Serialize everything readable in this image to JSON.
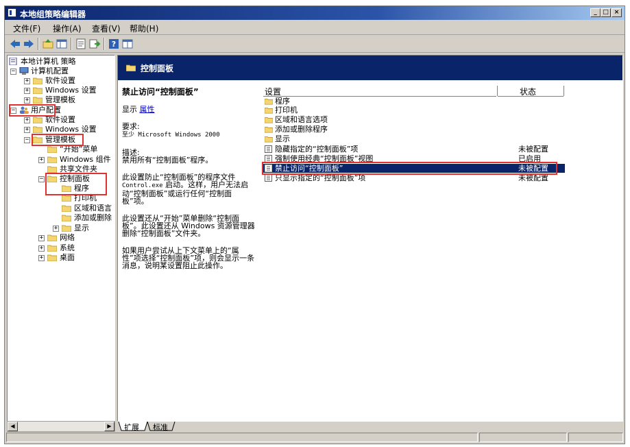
{
  "window": {
    "title": "本地组策略编辑器"
  },
  "menu": [
    "文件(F)",
    "操作(A)",
    "查看(V)",
    "帮助(H)"
  ],
  "tree": {
    "root": "本地计算机 策略",
    "computer_config": "计算机配置",
    "cc_software": "软件设置",
    "cc_windows": "Windows 设置",
    "cc_admin": "管理模板",
    "user_config": "用户配置",
    "uc_software": "软件设置",
    "uc_windows": "Windows 设置",
    "uc_admin": "管理模板",
    "start_menu": "“开始”菜单",
    "windows_components": "Windows 组件",
    "shared_folders": "共享文件夹",
    "control_panel": "控制面板",
    "cp_programs": "程序",
    "cp_printers": "打印机",
    "cp_regional": "区域和语言",
    "cp_addremove": "添加或删除",
    "cp_display": "显示",
    "network": "网络",
    "system": "系统",
    "desktop": "桌面"
  },
  "right": {
    "header_title": "控制面板",
    "desc": {
      "heading": "禁止访问“控制面板”",
      "show_label": "显示",
      "properties_link": "属性",
      "req_label": "要求:",
      "req_value": "至少 Microsoft Windows 2000",
      "desc_label": "描述:",
      "desc_line": "禁用所有“控制面板”程序。",
      "para1a": "此设置防止“控制面板”的程序文件",
      "para1b": "Control.exe",
      "para1c": "启动。这样，用户无法启动“控制面板”或运行任何“控制面板”项。",
      "para2": "此设置还从“开始”菜单删除“控制面板”。此设置还从 Windows 资源管理器删除“控制面板”文件夹。",
      "para3": "如果用户尝试从上下文菜单上的“属性”项选择“控制面板”项，则会显示一条消息，说明某设置阻止此操作。"
    },
    "columns": {
      "setting": "设置",
      "state": "状态"
    },
    "folders": [
      "程序",
      "打印机",
      "区域和语言选项",
      "添加或删除程序",
      "显示"
    ],
    "policies": [
      {
        "name": "隐藏指定的“控制面板”项",
        "state": "未被配置"
      },
      {
        "name": "强制使用经典“控制面板”视图",
        "state": "已启用"
      },
      {
        "name": "禁止访问“控制面板”",
        "state": "未被配置"
      },
      {
        "name": "只显示指定的“控制面板”项",
        "state": "未被配置"
      }
    ]
  },
  "tabs": {
    "extended": "扩展",
    "standard": "标准"
  },
  "colors": {
    "title_blue": "#0a246a",
    "highlight_red": "#e03030",
    "folder": "#f3d671"
  }
}
